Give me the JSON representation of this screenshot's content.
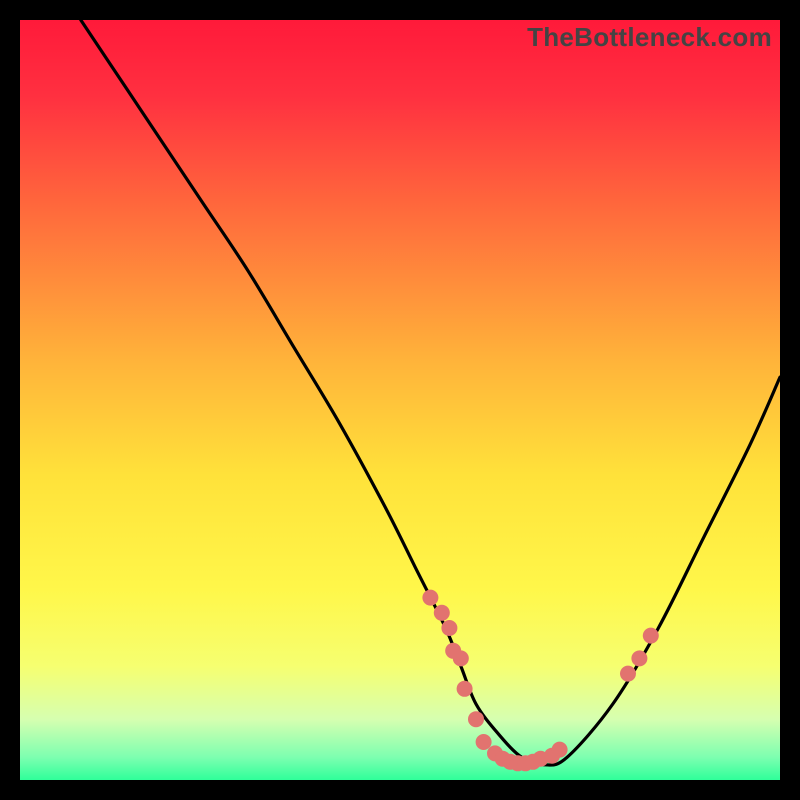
{
  "watermark": "TheBottleneck.com",
  "gradient": {
    "stops": [
      {
        "offset": "0%",
        "color": "#ff1a3a"
      },
      {
        "offset": "10%",
        "color": "#ff3040"
      },
      {
        "offset": "25%",
        "color": "#ff6a3c"
      },
      {
        "offset": "45%",
        "color": "#ffb43a"
      },
      {
        "offset": "60%",
        "color": "#ffe23a"
      },
      {
        "offset": "75%",
        "color": "#fff74a"
      },
      {
        "offset": "85%",
        "color": "#f6ff70"
      },
      {
        "offset": "92%",
        "color": "#d6ffb0"
      },
      {
        "offset": "97%",
        "color": "#7dffb0"
      },
      {
        "offset": "100%",
        "color": "#2fff9a"
      }
    ]
  },
  "chart_data": {
    "type": "line",
    "title": "",
    "xlabel": "",
    "ylabel": "",
    "xlim": [
      0,
      100
    ],
    "ylim": [
      0,
      100
    ],
    "series": [
      {
        "name": "bottleneck-curve",
        "x": [
          8,
          12,
          18,
          24,
          30,
          36,
          42,
          48,
          52,
          56,
          58,
          60,
          63,
          66,
          69,
          72,
          78,
          84,
          90,
          96,
          100
        ],
        "y": [
          100,
          94,
          85,
          76,
          67,
          57,
          47,
          36,
          28,
          20,
          15,
          10,
          6,
          3,
          2,
          3,
          10,
          20,
          32,
          44,
          53
        ]
      }
    ],
    "scatter": {
      "name": "data-points",
      "color": "#e2736f",
      "x": [
        54,
        55.5,
        56.5,
        57,
        58,
        58.5,
        60,
        61,
        62.5,
        63.5,
        64.5,
        65.5,
        66.5,
        67.5,
        68.5,
        70,
        71,
        80,
        81.5,
        83
      ],
      "y": [
        24,
        22,
        20,
        17,
        16,
        12,
        8,
        5,
        3.5,
        2.8,
        2.4,
        2.2,
        2.2,
        2.4,
        2.8,
        3.2,
        4,
        14,
        16,
        19
      ]
    }
  }
}
